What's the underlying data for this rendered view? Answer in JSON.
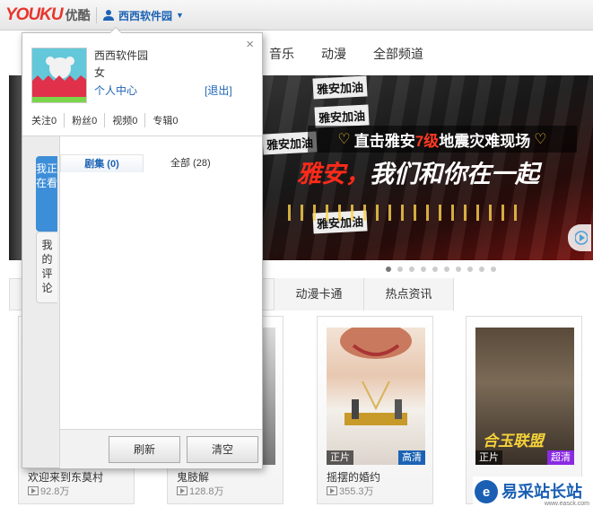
{
  "header": {
    "logo": "YOUKU",
    "logo_sub": "优酷",
    "username": "西西软件园"
  },
  "nav": [
    {
      "label": "音乐"
    },
    {
      "label": "动漫"
    },
    {
      "label": "全部频道"
    }
  ],
  "banner": {
    "headline_pre": "直击雅安",
    "headline_highlight": "7级",
    "headline_post": "地震灾难现场",
    "tagline_red": "雅安，",
    "tagline": "我们和你在一起",
    "signs": [
      "雅安加油",
      "雅安加油",
      "雅安加油",
      "雅安加油"
    ]
  },
  "carousel": {
    "count": 10,
    "active_index": 0
  },
  "category_tabs": [
    {
      "label": "动漫卡通"
    },
    {
      "label": "热点资讯"
    }
  ],
  "cards": [
    {
      "title": "欢迎来到东莫村",
      "views": "92.8万"
    },
    {
      "title": "鬼肢解",
      "views": "128.8万"
    },
    {
      "title": "摇摆的婚约",
      "views": "355.3万",
      "badge_left": "正片",
      "badge_right": "高清",
      "badge_right_color": "#1c63b5"
    },
    {
      "title": "",
      "views": "",
      "badge_left": "正片",
      "badge_right": "超清",
      "badge_right_color": "#8a2be2",
      "poster_text": "合玉联盟"
    }
  ],
  "watermark": {
    "text": "易采站长站",
    "url": "www.easck.com"
  },
  "panel": {
    "name": "西西软件园",
    "gender": "女",
    "center_link": "个人中心",
    "logout_link": "[退出]",
    "stats": [
      {
        "label": "关注0"
      },
      {
        "label": "粉丝0"
      },
      {
        "label": "视频0"
      },
      {
        "label": "专辑0"
      }
    ],
    "side_tabs": {
      "watching": "我正在看",
      "comments": "我的评论"
    },
    "sub_tabs": {
      "series": "剧集 (0)",
      "all": "全部 (28)"
    },
    "buttons": {
      "refresh": "刷新",
      "clear": "清空"
    }
  }
}
